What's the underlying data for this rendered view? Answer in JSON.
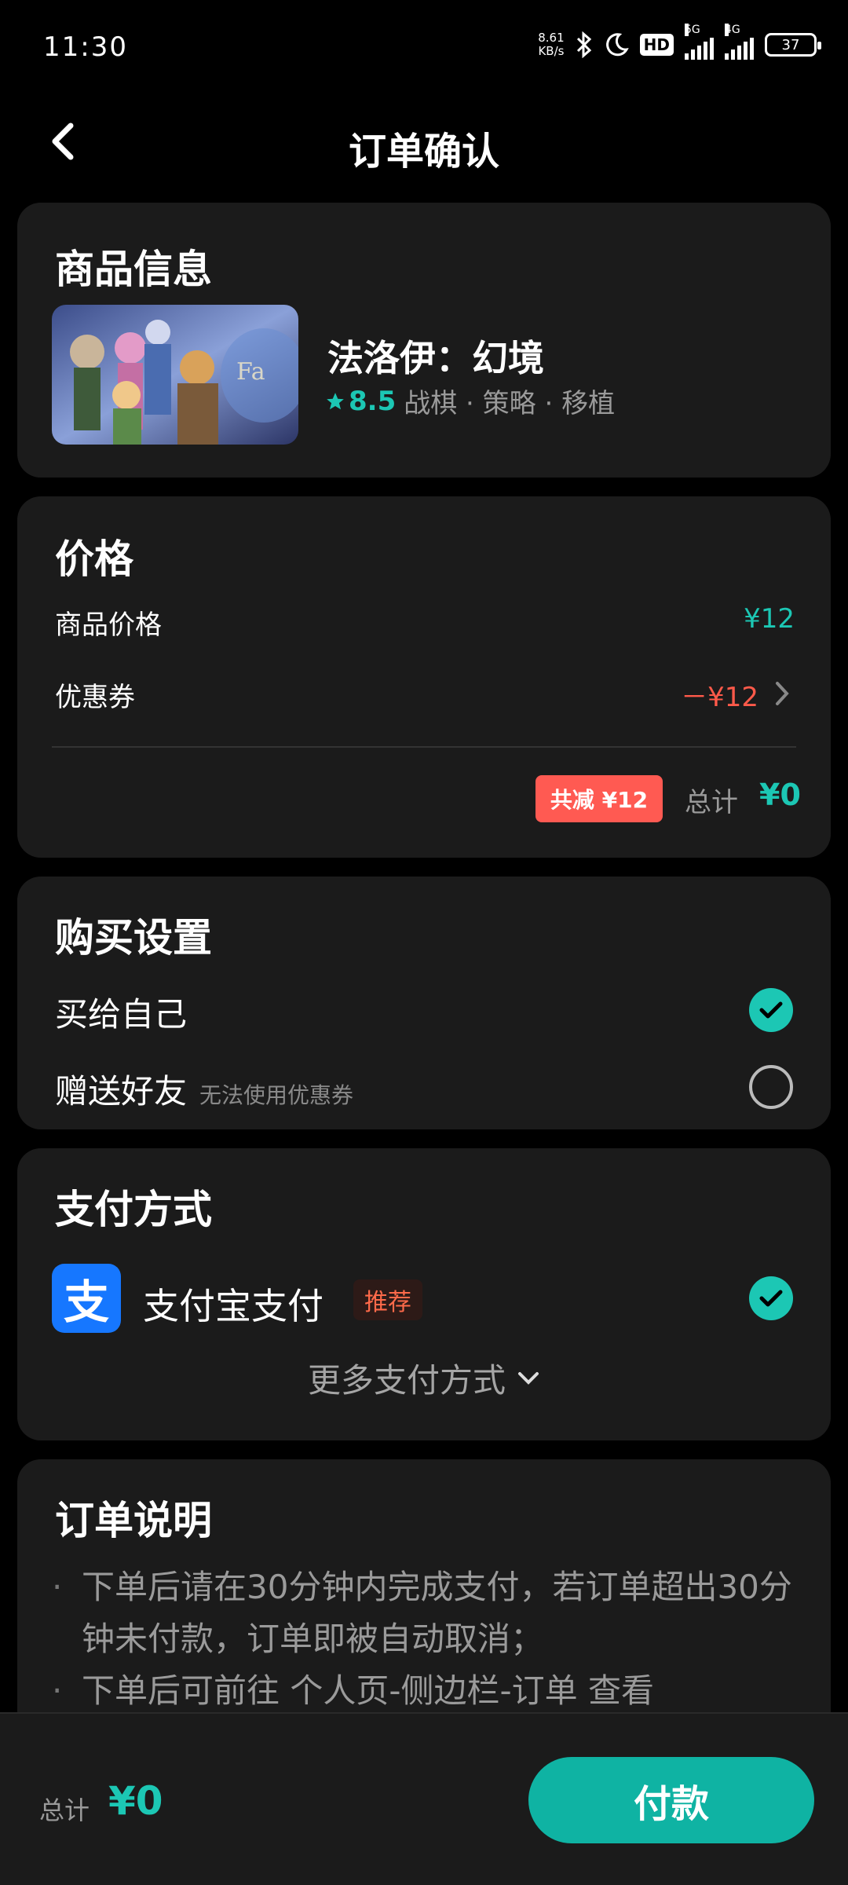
{
  "status_bar": {
    "time": "11:30",
    "net_speed_value": "8.61",
    "net_speed_unit": "KB/s",
    "hd_label": "HD",
    "network_1": "5G",
    "network_2": "4G",
    "battery": "37"
  },
  "header": {
    "title": "订单确认"
  },
  "product": {
    "section_title": "商品信息",
    "name": "法洛伊：幻境",
    "rating": "8.5",
    "tags": "战棋 · 策略 · 移植"
  },
  "price": {
    "section_title": "价格",
    "item_price_label": "商品价格",
    "item_price_value": "¥12",
    "coupon_label": "优惠券",
    "coupon_value": "－¥12",
    "discount_badge": "共减 ¥12",
    "total_label": "总计",
    "total_value": "¥0"
  },
  "purchase": {
    "section_title": "购买设置",
    "self_label": "买给自己",
    "gift_label": "赠送好友",
    "gift_note": "无法使用优惠券"
  },
  "payment": {
    "section_title": "支付方式",
    "alipay_icon_char": "支",
    "alipay_label": "支付宝支付",
    "recommend_badge": "推荐",
    "more_label": "更多支付方式"
  },
  "notes": {
    "section_title": "订单说明",
    "items": [
      "下单后请在30分钟内完成支付，若订单超出30分钟未付款，订单即被自动取消；",
      "下单后可前往 个人页-侧边栏-订单 查看"
    ]
  },
  "bottom_bar": {
    "total_label": "总计",
    "total_value": "¥0",
    "pay_button": "付款"
  },
  "colors": {
    "accent": "#1cc7b4",
    "discount": "#ff5a52",
    "alipay": "#1677ff",
    "card_bg": "#1b1b1b"
  }
}
